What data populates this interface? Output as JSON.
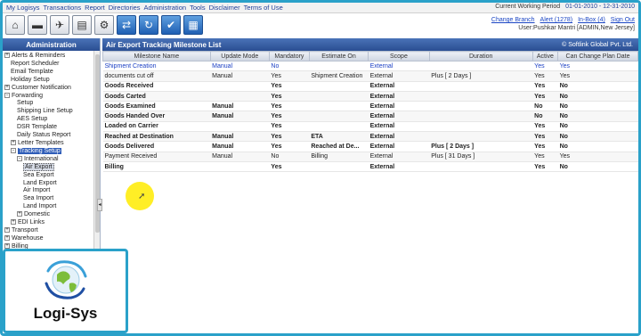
{
  "menubar": {
    "items": [
      "My Logisys",
      "Transactions",
      "Report",
      "Directories",
      "Administration",
      "Tools",
      "Disclaimer",
      "Terms of Use"
    ],
    "period_label": "Current Working Period",
    "period_value": "01-01-2010 - 12-31-2010"
  },
  "toolbar": {
    "icons": [
      "warehouse-icon",
      "truck-icon",
      "airplane-icon",
      "report-icon",
      "settings-icon",
      "transfer-icon",
      "refresh-icon",
      "checklist-icon",
      "document-icon"
    ],
    "change_branch": "Change Branch",
    "alert": "Alert (1278)",
    "inbox": "In-Box (4)",
    "sign_out": "Sign Out",
    "user": "User:Pushkar Mantri [ADMIN,New Jersey]"
  },
  "sidebar": {
    "title": "Administration",
    "tree": [
      {
        "label": "Alerts & Reminders",
        "level": 0,
        "expander": "+"
      },
      {
        "label": "Report Scheduler",
        "level": 1
      },
      {
        "label": "Email Template",
        "level": 1
      },
      {
        "label": "Holiday Setup",
        "level": 1
      },
      {
        "label": "Customer Notification",
        "level": 0,
        "expander": "+"
      },
      {
        "label": "Forwarding",
        "level": 0,
        "expander": "-"
      },
      {
        "label": "Setup",
        "level": 2
      },
      {
        "label": "Shipping Line Setup",
        "level": 2
      },
      {
        "label": "AES Setup",
        "level": 2
      },
      {
        "label": "DSR Template",
        "level": 2
      },
      {
        "label": "Daily Status Report",
        "level": 2
      },
      {
        "label": "Letter Templates",
        "level": 1,
        "expander": "+"
      },
      {
        "label": "Tracking Setup",
        "level": 1,
        "expander": "-",
        "selected": true
      },
      {
        "label": "International",
        "level": 2,
        "expander": "-"
      },
      {
        "label": "Air Export",
        "level": 3,
        "current": true
      },
      {
        "label": "Sea Export",
        "level": 3
      },
      {
        "label": "Land Export",
        "level": 3
      },
      {
        "label": "Air Import",
        "level": 3
      },
      {
        "label": "Sea Import",
        "level": 3
      },
      {
        "label": "Land Import",
        "level": 3
      },
      {
        "label": "Domestic",
        "level": 2,
        "expander": "+"
      },
      {
        "label": "EDI Links",
        "level": 1,
        "expander": "+"
      },
      {
        "label": "Transport",
        "level": 0,
        "expander": "+"
      },
      {
        "label": "Warehouse",
        "level": 0,
        "expander": "+"
      },
      {
        "label": "Billing",
        "level": 0,
        "expander": "+"
      }
    ]
  },
  "main": {
    "title": "Air Export Tracking Milestone List",
    "copyright": "© Softlink Global Pvt. Ltd.",
    "columns": [
      "Milestone Name",
      "Update Mode",
      "Mandatory",
      "Estimate On",
      "Scope",
      "Duration",
      "Active",
      "Can Change Plan Date"
    ],
    "rows": [
      {
        "cells": [
          "Shipment Creation",
          "Manual",
          "No",
          "",
          "External",
          "",
          "Yes",
          "Yes"
        ],
        "style": "first"
      },
      {
        "cells": [
          "documents cut off",
          "Manual",
          "Yes",
          "Shipment Creation",
          "External",
          "Plus [ 2 Days ]",
          "Yes",
          "Yes"
        ],
        "style": "normal"
      },
      {
        "cells": [
          "Goods Received",
          "",
          "Yes",
          "",
          "External",
          "",
          "Yes",
          "No"
        ],
        "style": "bold"
      },
      {
        "cells": [
          "Goods Carted",
          "",
          "Yes",
          "",
          "External",
          "",
          "Yes",
          "No"
        ],
        "style": "bold"
      },
      {
        "cells": [
          "Goods Examined",
          "Manual",
          "Yes",
          "",
          "External",
          "",
          "No",
          "No"
        ],
        "style": "bold"
      },
      {
        "cells": [
          "Goods Handed Over",
          "Manual",
          "Yes",
          "",
          "External",
          "",
          "No",
          "No"
        ],
        "style": "bold"
      },
      {
        "cells": [
          "Loaded on Carrier",
          "",
          "Yes",
          "",
          "External",
          "",
          "Yes",
          "No"
        ],
        "style": "bold"
      },
      {
        "cells": [
          "Reached at Destination",
          "Manual",
          "Yes",
          "ETA",
          "External",
          "",
          "Yes",
          "No"
        ],
        "style": "bold"
      },
      {
        "cells": [
          "Goods Delivered",
          "Manual",
          "Yes",
          "Reached at De...",
          "External",
          "Plus [ 2 Days ]",
          "Yes",
          "No"
        ],
        "style": "bold"
      },
      {
        "cells": [
          "Payment Received",
          "Manual",
          "No",
          "Billing",
          "External",
          "Plus [ 31 Days ]",
          "Yes",
          "Yes"
        ],
        "style": "normal"
      },
      {
        "cells": [
          "Billing",
          "",
          "Yes",
          "",
          "External",
          "",
          "Yes",
          "No"
        ],
        "style": "bold"
      }
    ]
  },
  "logo": {
    "brand": "Logi-Sys"
  }
}
